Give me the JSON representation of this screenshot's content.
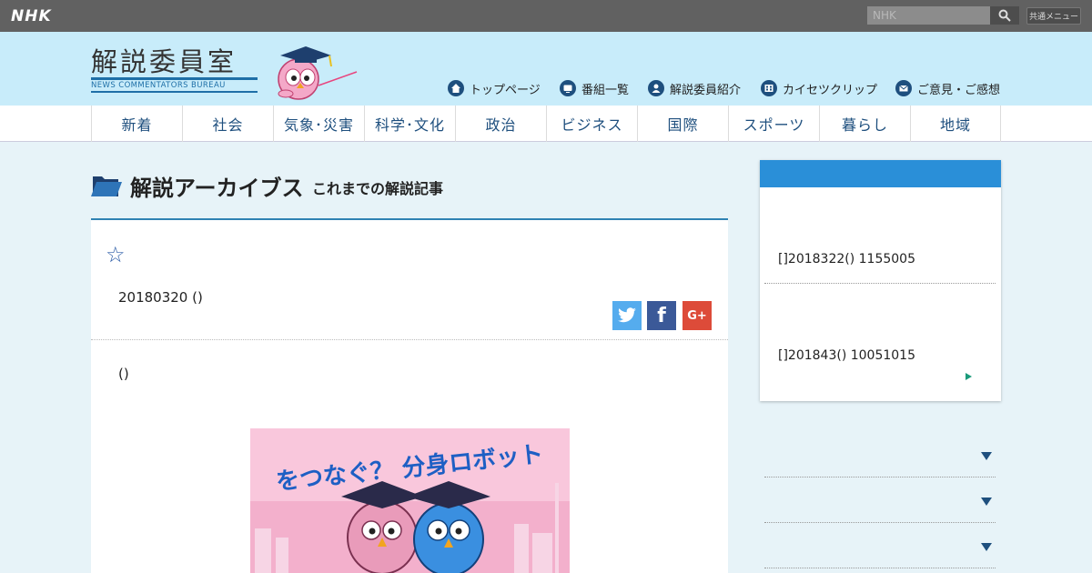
{
  "topbar": {
    "logo": "NHK",
    "search_placeholder": "NHK",
    "common_menu": "共通メニュー"
  },
  "header": {
    "site_title": "解説委員室",
    "site_subtitle": "NEWS COMMENTATORS BUREAU",
    "nav": [
      {
        "label": "トップページ",
        "icon": "home-icon"
      },
      {
        "label": "番組一覧",
        "icon": "tv-icon"
      },
      {
        "label": "解説委員紹介",
        "icon": "person-icon"
      },
      {
        "label": "カイセツクリップ",
        "icon": "film-icon"
      },
      {
        "label": "ご意見・ご感想",
        "icon": "mail-icon"
      }
    ]
  },
  "categories": [
    "新着",
    "社会",
    "気象･災害",
    "科学･文化",
    "政治",
    "ビジネス",
    "国際",
    "スポーツ",
    "暮らし",
    "地域"
  ],
  "archive": {
    "title": "解説アーカイブス",
    "subtitle": "これまでの解説記事"
  },
  "article": {
    "star": "☆",
    "date": "20180320 ()",
    "lead": "()",
    "image_text": "をつなぐ？ 分身ロボット"
  },
  "sidebar": {
    "items": [
      {
        "label": "[]2018322() 1155005"
      },
      {
        "label": "[]201843() 10051015"
      }
    ]
  },
  "colors": {
    "topbar": "#616161",
    "header": "#c8ecfa",
    "accent": "#1e4f7e",
    "sidebar_head": "#2a8fd8"
  }
}
